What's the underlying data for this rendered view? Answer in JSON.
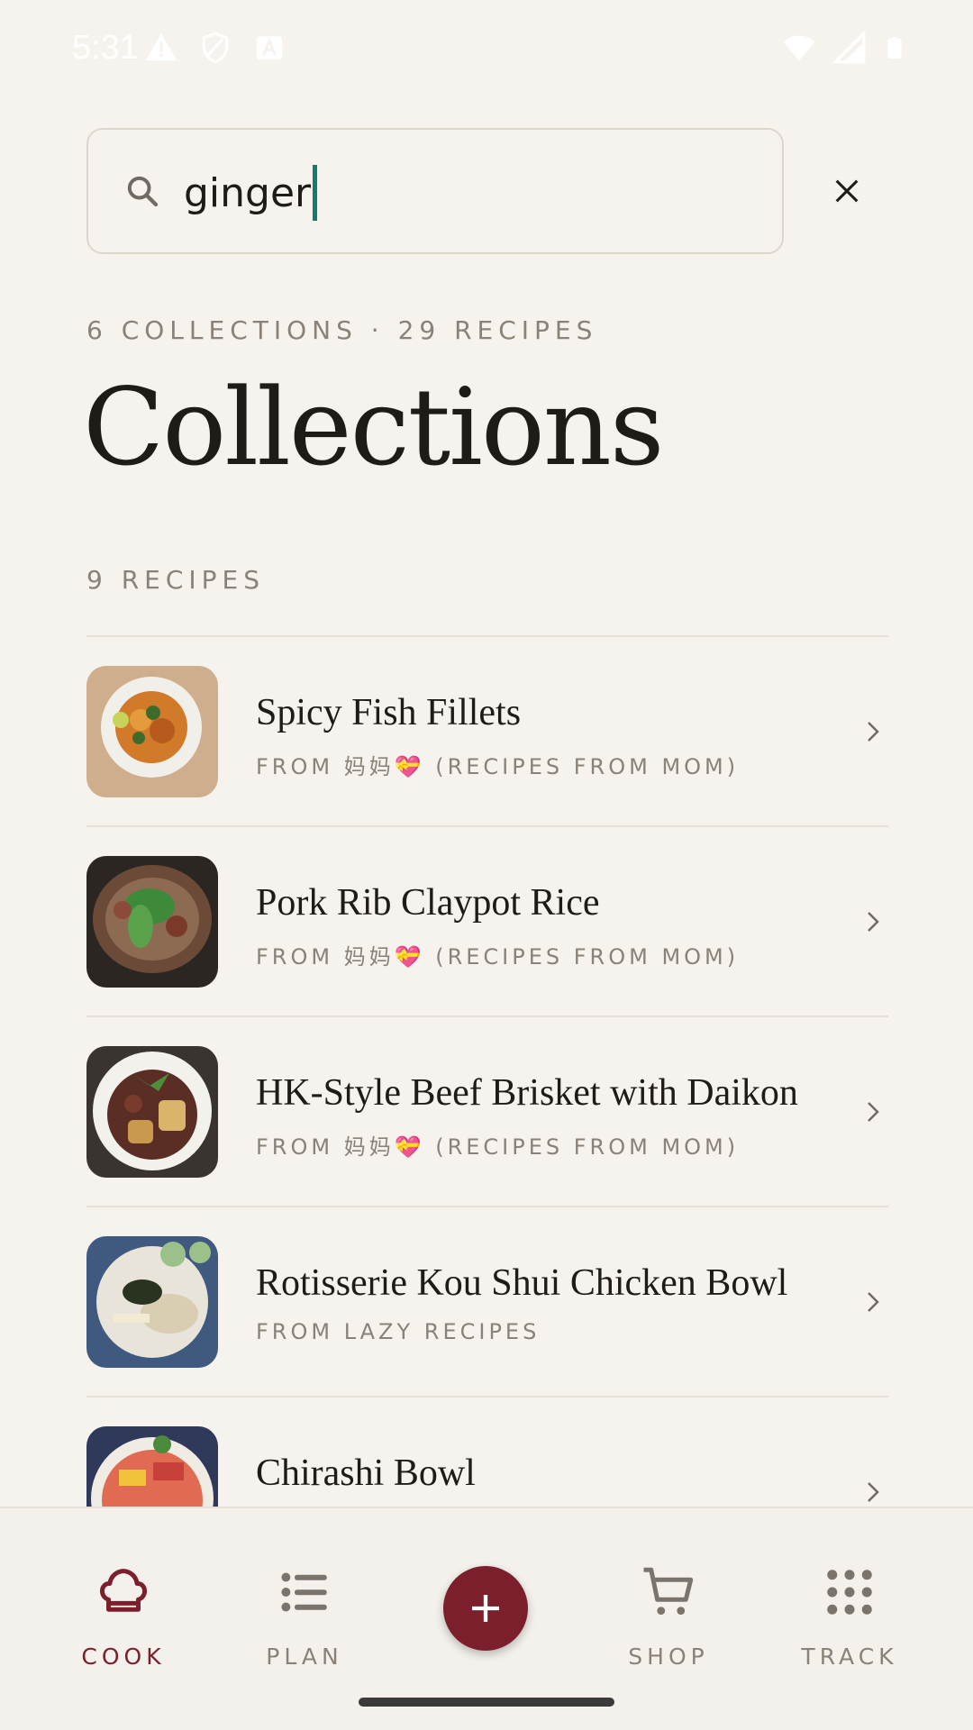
{
  "status_bar": {
    "time": "5:31",
    "left_icons": [
      "warning-icon",
      "shield-icon",
      "font-a-icon"
    ],
    "right_icons": [
      "wifi-icon",
      "cell-signal-icon",
      "battery-icon"
    ]
  },
  "search": {
    "value": "ginger",
    "icon": "search-icon",
    "clear_icon": "close-icon"
  },
  "summary": "6 COLLECTIONS · 29 RECIPES",
  "title": "Collections",
  "section_label": "9 RECIPES",
  "recipes": [
    {
      "title": "Spicy Fish Fillets",
      "source": "FROM 妈妈💝 (RECIPES FROM MOM)"
    },
    {
      "title": "Pork Rib Claypot Rice",
      "source": "FROM 妈妈💝 (RECIPES FROM MOM)"
    },
    {
      "title": "HK-Style Beef Brisket with Daikon",
      "source": "FROM 妈妈💝 (RECIPES FROM MOM)"
    },
    {
      "title": "Rotisserie Kou Shui Chicken Bowl",
      "source": "FROM LAZY RECIPES"
    },
    {
      "title": "Chirashi Bowl",
      "source": ""
    }
  ],
  "nav": {
    "cook": "COOK",
    "plan": "PLAN",
    "shop": "SHOP",
    "track": "TRACK",
    "active": "cook"
  },
  "colors": {
    "background": "#f6f3ee",
    "accent": "#7a1f2b",
    "caret": "#137a6e",
    "muted_text": "#8a8278"
  }
}
